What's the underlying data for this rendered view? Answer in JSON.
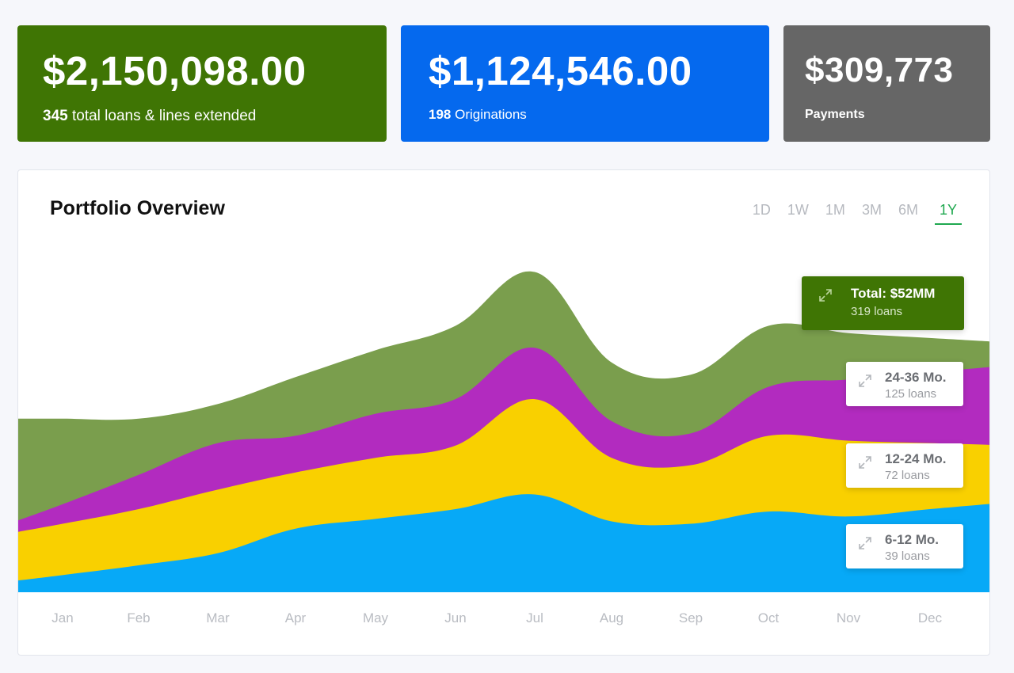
{
  "cards": {
    "total": {
      "amount": "$2,150,098.00",
      "count": "345",
      "caption": " total loans & lines extended",
      "color": "#3f7504"
    },
    "originations": {
      "amount": "$1,124,546.00",
      "count": "198",
      "caption": " Originations",
      "color": "#0569ee"
    },
    "payments": {
      "amount": "$309,773",
      "caption": "Payments",
      "color": "#666666"
    }
  },
  "panel": {
    "title": "Portfolio Overview",
    "ranges": [
      "1D",
      "1W",
      "1M",
      "3M",
      "6M",
      "1Y"
    ],
    "active_range": "1Y"
  },
  "legend": {
    "total": {
      "title": "Total: $52MM",
      "sub": "319 loans",
      "icon": "expand-icon"
    },
    "m24_36": {
      "title": "24-36 Mo.",
      "sub": "125 loans",
      "icon": "expand-icon"
    },
    "m12_24": {
      "title": "12-24 Mo.",
      "sub": "72 loans",
      "icon": "expand-icon"
    },
    "m6_12": {
      "title": "6-12 Mo.",
      "sub": "39 loans",
      "icon": "expand-icon"
    }
  },
  "chart_data": {
    "type": "area",
    "stacked": true,
    "categories": [
      "Jan",
      "Feb",
      "Mar",
      "Apr",
      "May",
      "Jun",
      "Jul",
      "Aug",
      "Sep",
      "Oct",
      "Nov",
      "Dec"
    ],
    "grid": false,
    "legend_position": "right",
    "series": [
      {
        "name": "6-12 Mo.",
        "color": "#07a9f7",
        "values": [
          7,
          11,
          16,
          26,
          30,
          34,
          40,
          29,
          28,
          33,
          31,
          34
        ]
      },
      {
        "name": "12-24 Mo.",
        "color": "#f9d000",
        "values": [
          21,
          23,
          26,
          23,
          25,
          26,
          39,
          26,
          24,
          31,
          31,
          27
        ]
      },
      {
        "name": "24-36 Mo.",
        "color": "#b22bbf",
        "values": [
          8,
          14,
          19,
          15,
          18,
          19,
          21,
          15,
          13,
          20,
          25,
          29
        ]
      },
      {
        "name": "Total",
        "color": "#7a9e4d",
        "values": [
          35,
          23,
          16,
          24,
          26,
          30,
          31,
          24,
          24,
          25,
          19,
          14
        ]
      }
    ],
    "ylim": [
      0,
      160
    ]
  }
}
